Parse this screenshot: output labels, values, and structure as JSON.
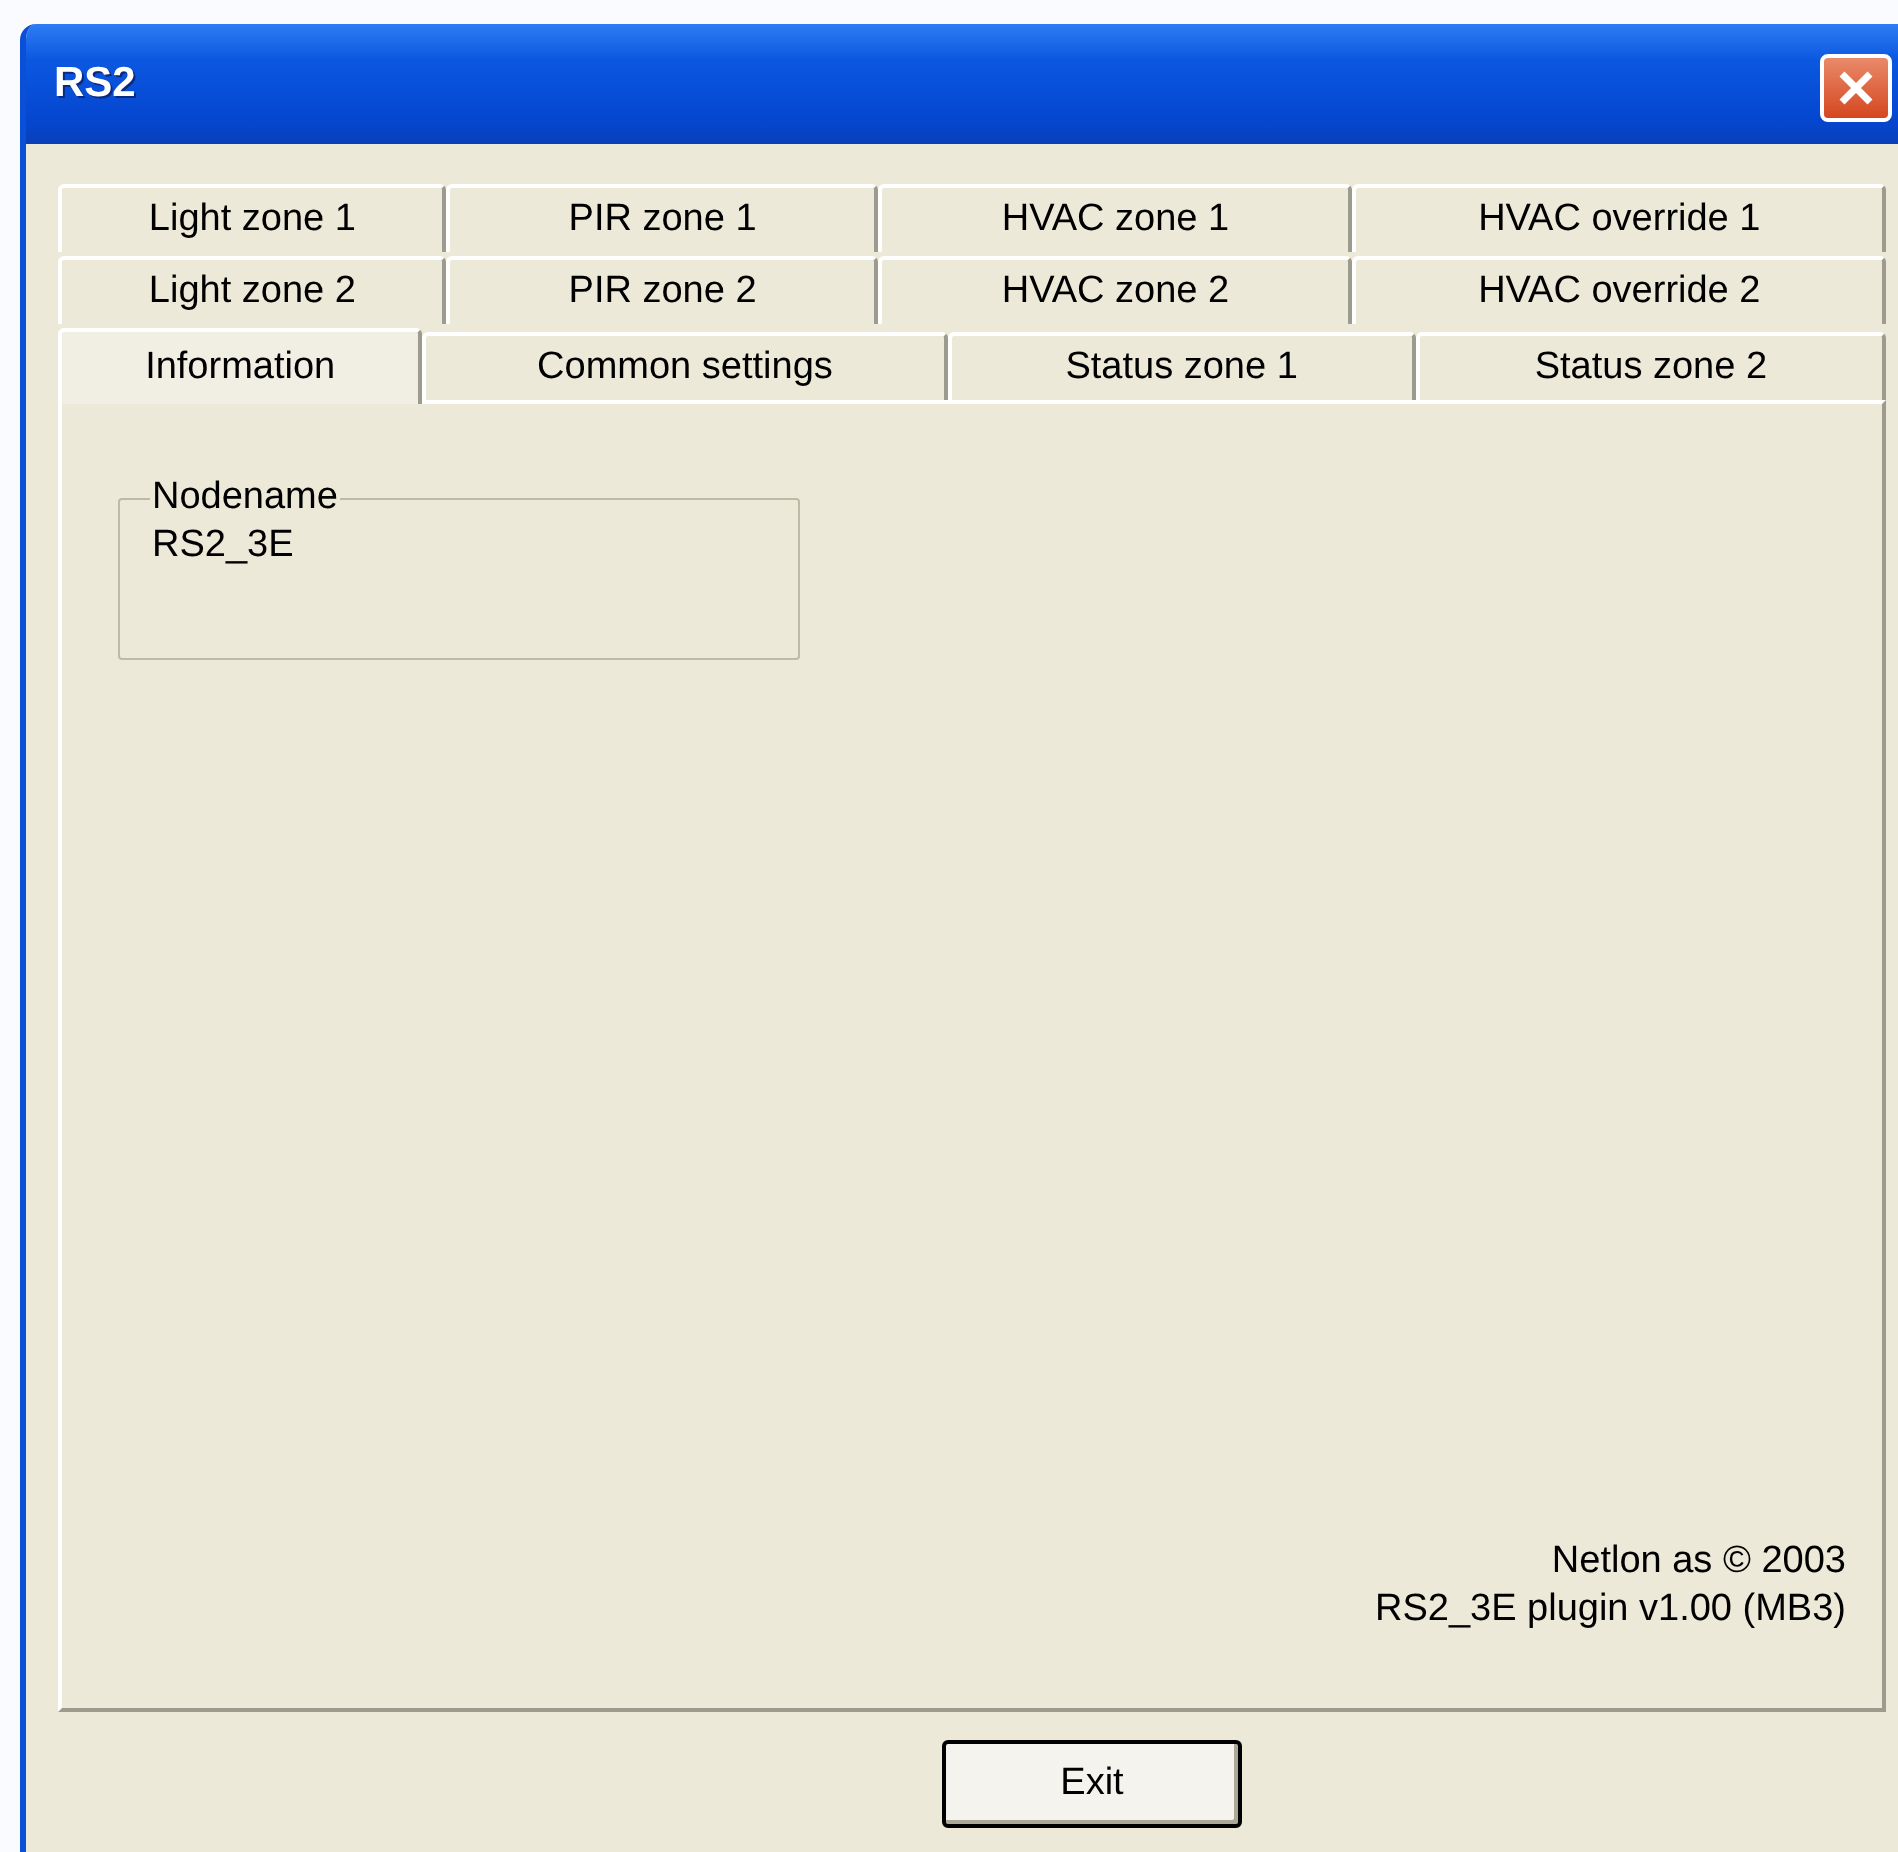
{
  "window": {
    "title": "RS2"
  },
  "tab_rows": [
    [
      {
        "label": "Light zone 1",
        "selected": false
      },
      {
        "label": "PIR zone 1",
        "selected": false
      },
      {
        "label": "HVAC zone 1",
        "selected": false
      },
      {
        "label": "HVAC override 1",
        "selected": false
      }
    ],
    [
      {
        "label": "Light zone 2",
        "selected": false
      },
      {
        "label": "PIR zone 2",
        "selected": false
      },
      {
        "label": "HVAC zone 2",
        "selected": false
      },
      {
        "label": "HVAC override 2",
        "selected": false
      }
    ],
    [
      {
        "label": "Information",
        "selected": true
      },
      {
        "label": "Common settings",
        "selected": false
      },
      {
        "label": "Status zone 1",
        "selected": false
      },
      {
        "label": "Status zone 2",
        "selected": false
      }
    ]
  ],
  "group": {
    "label": "Nodename",
    "value": "RS2_3E"
  },
  "footer": [
    "Netlon as © 2003",
    "RS2_3E plugin v1.00 (MB3)"
  ],
  "buttons": [
    "Exit"
  ]
}
